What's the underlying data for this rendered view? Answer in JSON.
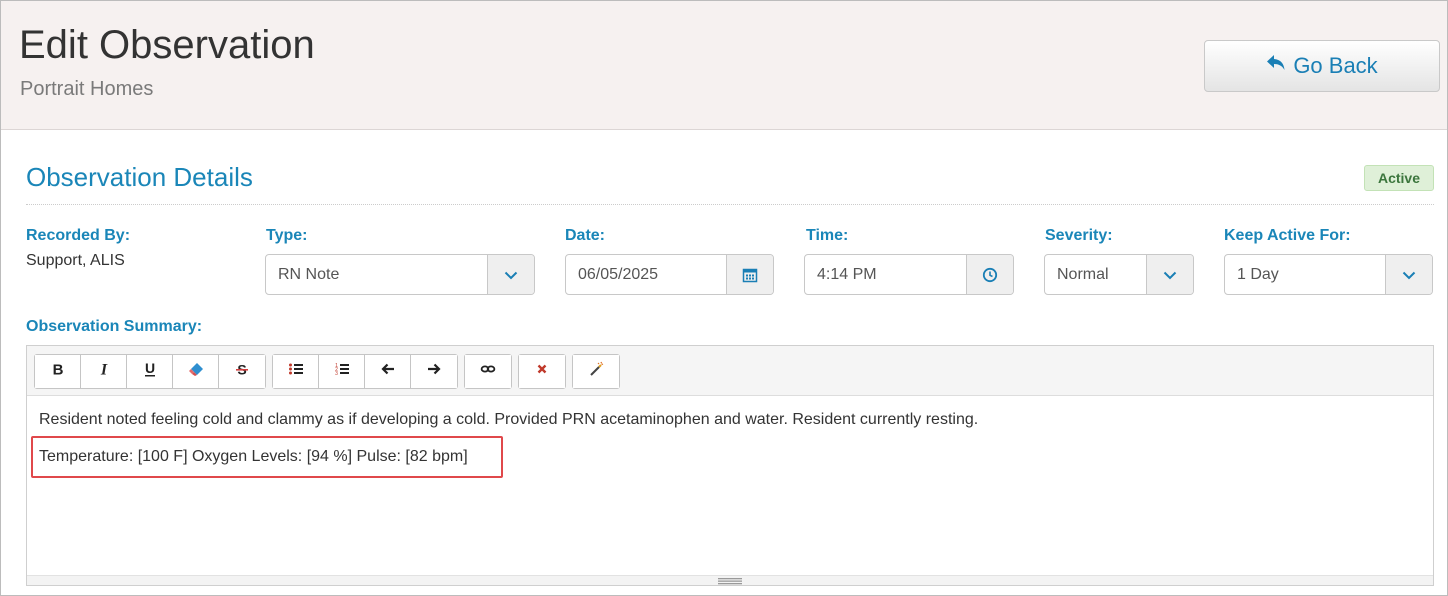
{
  "header": {
    "title": "Edit Observation",
    "subtitle": "Portrait Homes",
    "back_label": "Go Back"
  },
  "section": {
    "title": "Observation Details",
    "status": "Active"
  },
  "fields": {
    "recorded_by": {
      "label": "Recorded By:",
      "value": "Support, ALIS"
    },
    "type": {
      "label": "Type:",
      "value": "RN Note"
    },
    "date": {
      "label": "Date:",
      "value": "06/05/2025"
    },
    "time": {
      "label": "Time:",
      "value": "4:14 PM"
    },
    "severity": {
      "label": "Severity:",
      "value": "Normal"
    },
    "keep_active": {
      "label": "Keep Active For:",
      "value": "1 Day"
    }
  },
  "summary": {
    "label": "Observation Summary:",
    "lines": [
      "Resident noted feeling cold and clammy as if developing a cold. Provided PRN acetaminophen and water. Resident currently resting.",
      "Temperature: [100 F] Oxygen Levels: [94 %] Pulse: [82 bpm]"
    ]
  },
  "toolbar": {
    "groups": [
      [
        "bold-icon",
        "italic-icon",
        "underline-icon",
        "eraser-icon",
        "strikethrough-icon"
      ],
      [
        "bulleted-list-icon",
        "numbered-list-icon",
        "outdent-icon",
        "indent-icon"
      ],
      [
        "link-icon"
      ],
      [
        "remove-icon"
      ],
      [
        "magic-wand-icon"
      ]
    ]
  },
  "colors": {
    "accent": "#1a86b8",
    "header_bg": "#f6f1f0",
    "status_bg": "#dff0d8",
    "status_text": "#3c763d",
    "highlight": "#e0484b"
  }
}
